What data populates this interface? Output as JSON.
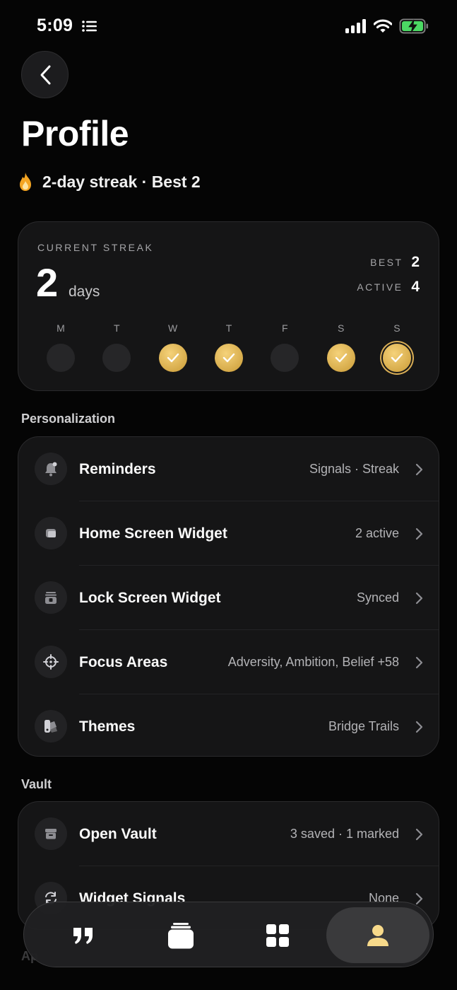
{
  "status_bar": {
    "time": "5:09"
  },
  "header": {
    "title": "Profile",
    "streak_summary": "2-day streak · Best 2"
  },
  "streak_card": {
    "caption": "CURRENT STREAK",
    "value": "2",
    "unit": "days",
    "best_label": "BEST",
    "best_value": "2",
    "active_label": "ACTIVE",
    "active_value": "4",
    "week": [
      {
        "letter": "M",
        "done": false
      },
      {
        "letter": "T",
        "done": false
      },
      {
        "letter": "W",
        "done": true
      },
      {
        "letter": "T",
        "done": true
      },
      {
        "letter": "F",
        "done": false
      },
      {
        "letter": "S",
        "done": true
      },
      {
        "letter": "S",
        "done": true,
        "today": true
      }
    ]
  },
  "personalization": {
    "section_title": "Personalization",
    "items": [
      {
        "label": "Reminders",
        "value": "Signals · Streak",
        "icon": "bell-icon"
      },
      {
        "label": "Home Screen Widget",
        "value": "2 active",
        "icon": "widget-icon"
      },
      {
        "label": "Lock Screen Widget",
        "value": "Synced",
        "icon": "lock-icon"
      },
      {
        "label": "Focus Areas",
        "value": "Adversity, Ambition, Belief +58",
        "icon": "crosshair-icon"
      },
      {
        "label": "Themes",
        "value": "Bridge Trails",
        "icon": "palette-icon"
      }
    ]
  },
  "vault": {
    "section_title": "Vault",
    "items": [
      {
        "label": "Open Vault",
        "value": "3 saved · 1 marked",
        "icon": "archive-icon"
      },
      {
        "label": "Widget Signals",
        "value": "None",
        "icon": "refresh-icon"
      }
    ]
  },
  "next_section_fragment": "Ap",
  "tab_bar": {
    "tabs": [
      "quotes-icon",
      "cards-icon",
      "grid-icon",
      "profile-icon"
    ],
    "active": "profile-icon"
  },
  "colors": {
    "accent_gold": "#e6be63",
    "background": "#050505",
    "card": "#151516"
  }
}
